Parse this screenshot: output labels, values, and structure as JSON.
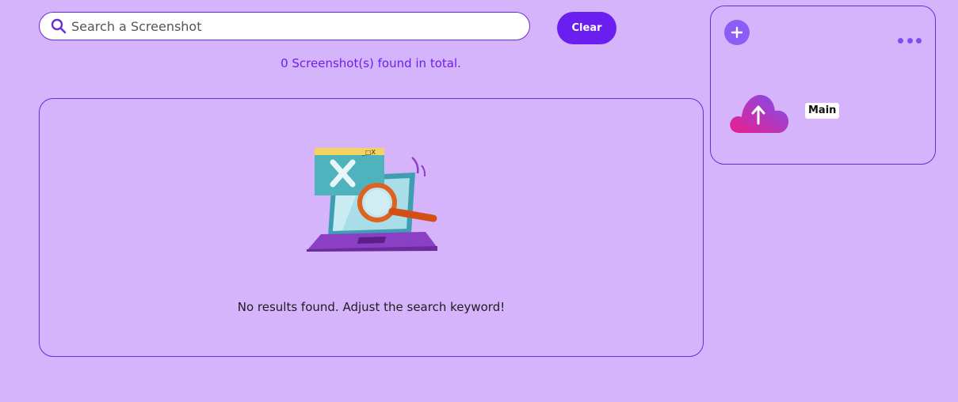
{
  "search": {
    "placeholder": "Search a Screenshot",
    "value": "",
    "clear_label": "Clear"
  },
  "results": {
    "count_text": "0 Screenshot(s) found in total.",
    "empty_message": "No results found. Adjust the search keyword!",
    "illustration_icon": "laptop-magnifier-no-results-icon"
  },
  "side_panel": {
    "add_icon": "plus-icon",
    "more_icon": "ellipsis-icon",
    "upload_icon": "cloud-upload-icon",
    "album_label": "Main"
  },
  "colors": {
    "background": "#d6b4fc",
    "accent": "#6a1ef0",
    "border": "#6a2cd8"
  }
}
